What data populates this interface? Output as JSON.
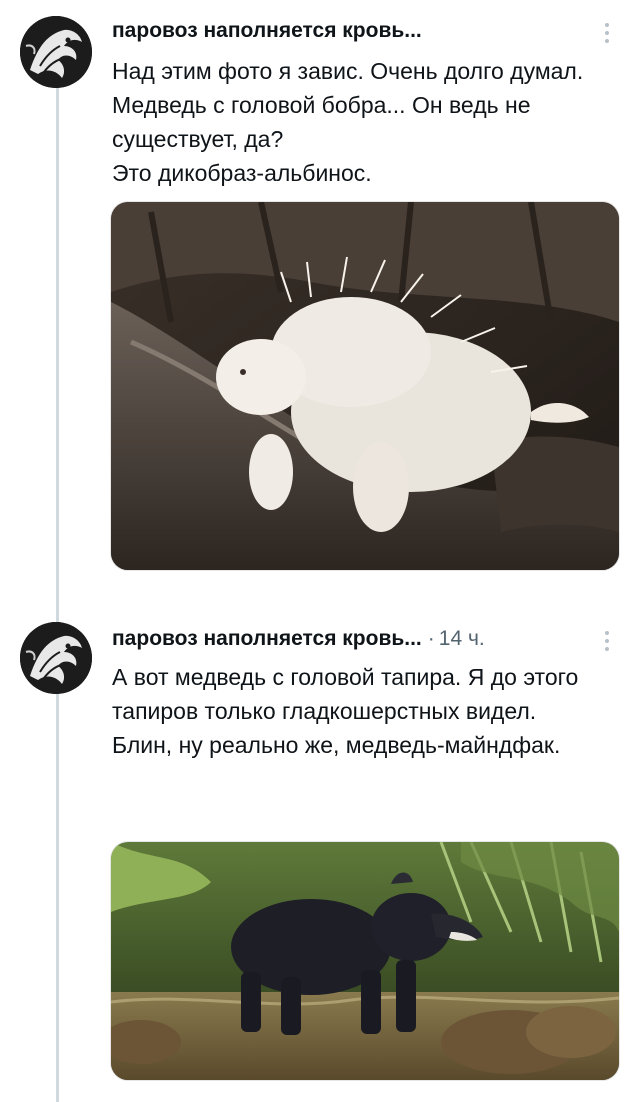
{
  "tweets": [
    {
      "author": "паровоз наполняется кровь...",
      "time": "",
      "text": [
        "Над этим фото я завис. Очень долго думал. Медведь с головой бобра... Он ведь не существует, да?",
        "Это дикобраз-альбинос."
      ],
      "media_icon": "albino-porcupine-photo"
    },
    {
      "author": "паровоз наполняется кровь...",
      "separator": "·",
      "time": "14 ч.",
      "text": [
        "А вот медведь с головой тапира. Я до этого тапиров только гладкошерстных видел.",
        "Блин, ну реально же, медведь-майндфак."
      ],
      "media_icon": "tapir-photo"
    }
  ],
  "icons": {
    "more": "vertical-dots-icon",
    "avatar": "avatar-illustration"
  },
  "colors": {
    "text": "#0f1419",
    "secondary": "#536471",
    "thread_line": "#cfd9de"
  }
}
